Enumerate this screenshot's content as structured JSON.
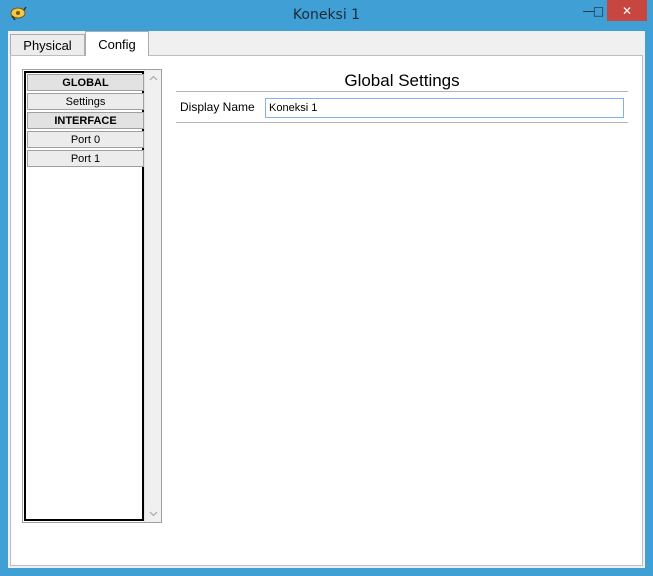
{
  "window": {
    "title": "Koneksi 1",
    "controls": {
      "minimize": "—",
      "maximize": "□",
      "close": "✕"
    }
  },
  "tabs": [
    {
      "label": "Physical",
      "selected": false
    },
    {
      "label": "Config",
      "selected": true
    }
  ],
  "nav": {
    "items": [
      {
        "label": "GLOBAL",
        "type": "header"
      },
      {
        "label": "Settings",
        "type": "item"
      },
      {
        "label": "INTERFACE",
        "type": "header"
      },
      {
        "label": "Port 0",
        "type": "item"
      },
      {
        "label": "Port 1",
        "type": "item"
      }
    ]
  },
  "global_settings": {
    "title": "Global Settings",
    "display_name_label": "Display Name",
    "display_name_value": "Koneksi 1"
  },
  "icons": {
    "app": "cable-connection-icon",
    "scroll_up": "chevron-up-icon",
    "scroll_down": "chevron-down-icon"
  },
  "colors": {
    "window_frame": "#40a0d6",
    "close_button": "#c7463f",
    "input_border": "#7eb4ea"
  }
}
